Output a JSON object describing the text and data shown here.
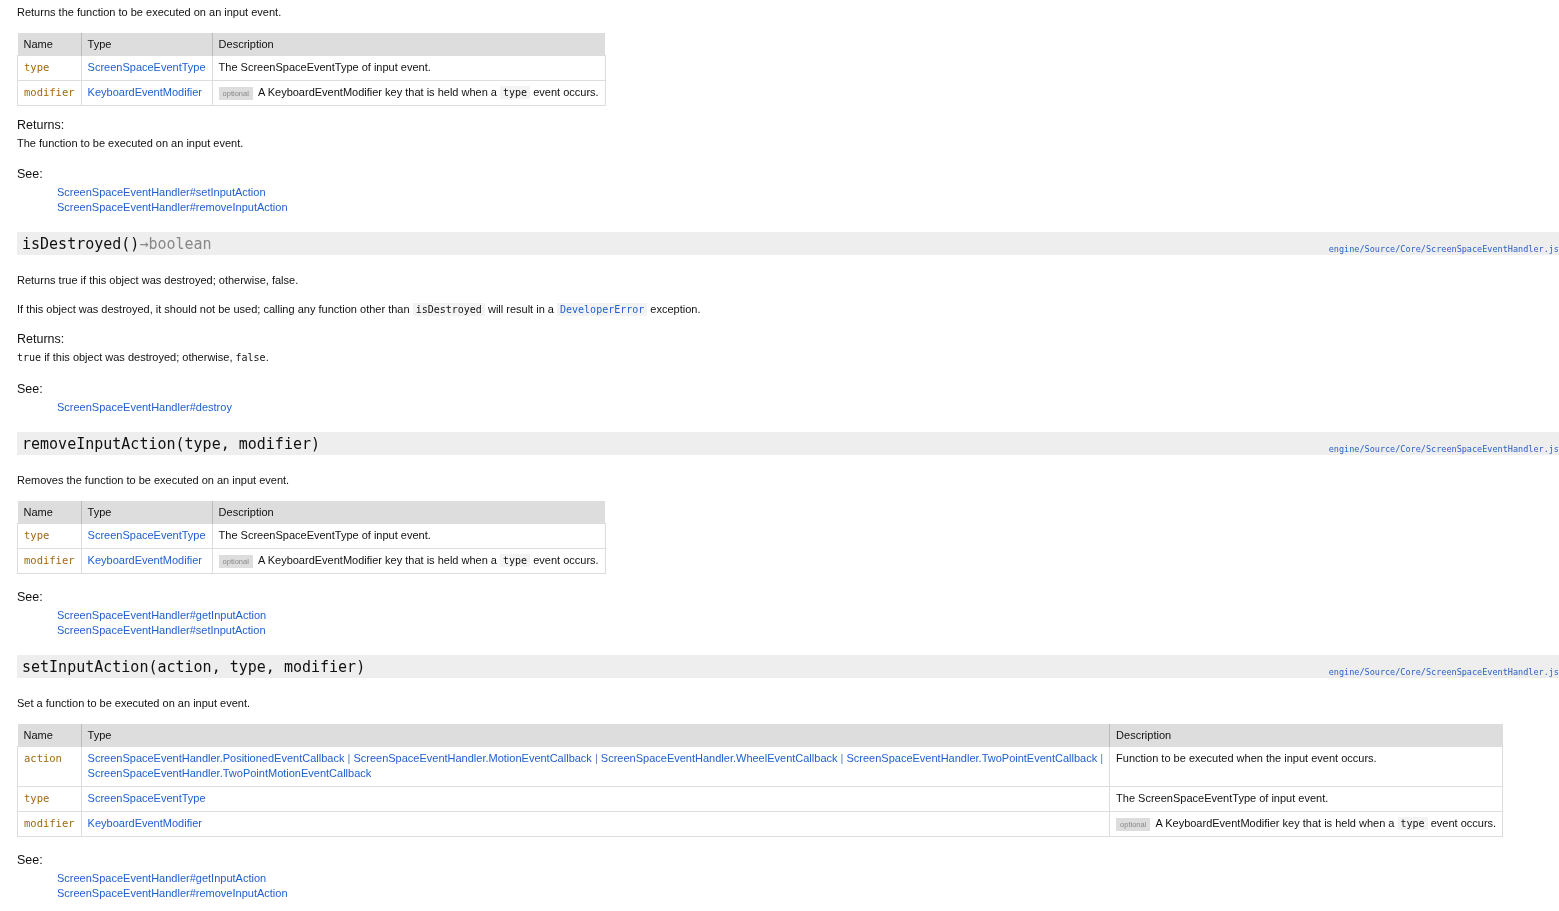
{
  "blocks": [
    {
      "kind": "paragraph",
      "parts": [
        {
          "kind": "text",
          "text": "Returns the function to be executed on an input event."
        }
      ]
    },
    {
      "kind": "params",
      "columns": [
        "Name",
        "Type",
        "Description"
      ],
      "rows": [
        {
          "name": "type",
          "type_lines": [
            [
              {
                "kind": "link",
                "text": "ScreenSpaceEventType"
              }
            ]
          ],
          "optional": false,
          "description": [
            {
              "kind": "text",
              "text": "The ScreenSpaceEventType of input event."
            }
          ]
        },
        {
          "name": "modifier",
          "type_lines": [
            [
              {
                "kind": "link",
                "text": "KeyboardEventModifier"
              }
            ]
          ],
          "optional": true,
          "optional_label": "optional",
          "description": [
            {
              "kind": "text",
              "text": "A KeyboardEventModifier key that is held when a "
            },
            {
              "kind": "code",
              "text": "type"
            },
            {
              "kind": "text",
              "text": " event occurs."
            }
          ]
        }
      ]
    },
    {
      "kind": "returns",
      "label": "Returns:",
      "parts": [
        {
          "kind": "text",
          "text": "The function to be executed on an input event."
        }
      ]
    },
    {
      "kind": "see",
      "label": "See:",
      "links": [
        "ScreenSpaceEventHandler#setInputAction",
        "ScreenSpaceEventHandler#removeInputAction"
      ]
    },
    {
      "kind": "heading",
      "signature": "isDestroyed()",
      "arrow": "→",
      "return_type": "boolean",
      "source": "engine/Source/Core/ScreenSpaceEventHandler.js"
    },
    {
      "kind": "paragraph",
      "parts": [
        {
          "kind": "text",
          "text": "Returns true if this object was destroyed; otherwise, false."
        }
      ]
    },
    {
      "kind": "paragraph",
      "parts": [
        {
          "kind": "text",
          "text": "If this object was destroyed, it should not be used; calling any function other than "
        },
        {
          "kind": "code",
          "text": "isDestroyed"
        },
        {
          "kind": "text",
          "text": " will result in a "
        },
        {
          "kind": "codelink",
          "text": "DeveloperError"
        },
        {
          "kind": "text",
          "text": " exception."
        }
      ]
    },
    {
      "kind": "returns",
      "label": "Returns:",
      "parts": [
        {
          "kind": "mono",
          "text": "true"
        },
        {
          "kind": "text",
          "text": " if this object was destroyed; otherwise, "
        },
        {
          "kind": "mono",
          "text": "false"
        },
        {
          "kind": "text",
          "text": "."
        }
      ]
    },
    {
      "kind": "see",
      "label": "See:",
      "links": [
        "ScreenSpaceEventHandler#destroy"
      ]
    },
    {
      "kind": "heading",
      "signature": "removeInputAction(type, modifier)",
      "source": "engine/Source/Core/ScreenSpaceEventHandler.js"
    },
    {
      "kind": "paragraph",
      "parts": [
        {
          "kind": "text",
          "text": "Removes the function to be executed on an input event."
        }
      ]
    },
    {
      "kind": "params",
      "columns": [
        "Name",
        "Type",
        "Description"
      ],
      "rows": [
        {
          "name": "type",
          "type_lines": [
            [
              {
                "kind": "link",
                "text": "ScreenSpaceEventType"
              }
            ]
          ],
          "optional": false,
          "description": [
            {
              "kind": "text",
              "text": "The ScreenSpaceEventType of input event."
            }
          ]
        },
        {
          "name": "modifier",
          "type_lines": [
            [
              {
                "kind": "link",
                "text": "KeyboardEventModifier"
              }
            ]
          ],
          "optional": true,
          "optional_label": "optional",
          "description": [
            {
              "kind": "text",
              "text": "A KeyboardEventModifier key that is held when a "
            },
            {
              "kind": "code",
              "text": "type"
            },
            {
              "kind": "text",
              "text": " event occurs."
            }
          ]
        }
      ]
    },
    {
      "kind": "see",
      "label": "See:",
      "links": [
        "ScreenSpaceEventHandler#getInputAction",
        "ScreenSpaceEventHandler#setInputAction"
      ]
    },
    {
      "kind": "heading",
      "signature": "setInputAction(action, type, modifier)",
      "source": "engine/Source/Core/ScreenSpaceEventHandler.js"
    },
    {
      "kind": "paragraph",
      "parts": [
        {
          "kind": "text",
          "text": "Set a function to be executed on an input event."
        }
      ]
    },
    {
      "kind": "params",
      "columns": [
        "Name",
        "Type",
        "Description"
      ],
      "rows": [
        {
          "name": "action",
          "type_lines": [
            [
              {
                "kind": "link",
                "text": "ScreenSpaceEventHandler.PositionedEventCallback"
              },
              {
                "kind": "text",
                "text": " | "
              },
              {
                "kind": "link",
                "text": "ScreenSpaceEventHandler.MotionEventCallback"
              },
              {
                "kind": "text",
                "text": " | "
              },
              {
                "kind": "link",
                "text": "ScreenSpaceEventHandler.WheelEventCallback"
              },
              {
                "kind": "text",
                "text": " | "
              },
              {
                "kind": "link",
                "text": "ScreenSpaceEventHandler.TwoPointEventCallback"
              },
              {
                "kind": "text",
                "text": " |"
              }
            ],
            [
              {
                "kind": "link",
                "text": "ScreenSpaceEventHandler.TwoPointMotionEventCallback"
              }
            ]
          ],
          "optional": false,
          "description": [
            {
              "kind": "text",
              "text": "Function to be executed when the input event occurs."
            }
          ]
        },
        {
          "name": "type",
          "type_lines": [
            [
              {
                "kind": "link",
                "text": "ScreenSpaceEventType"
              }
            ]
          ],
          "optional": false,
          "description": [
            {
              "kind": "text",
              "text": "The ScreenSpaceEventType of input event."
            }
          ]
        },
        {
          "name": "modifier",
          "type_lines": [
            [
              {
                "kind": "link",
                "text": "KeyboardEventModifier"
              }
            ]
          ],
          "optional": true,
          "optional_label": "optional",
          "description": [
            {
              "kind": "text",
              "text": "A KeyboardEventModifier key that is held when a "
            },
            {
              "kind": "code",
              "text": "type"
            },
            {
              "kind": "text",
              "text": " event occurs."
            }
          ]
        }
      ]
    },
    {
      "kind": "see",
      "label": "See:",
      "links": [
        "ScreenSpaceEventHandler#getInputAction",
        "ScreenSpaceEventHandler#removeInputAction"
      ]
    }
  ]
}
